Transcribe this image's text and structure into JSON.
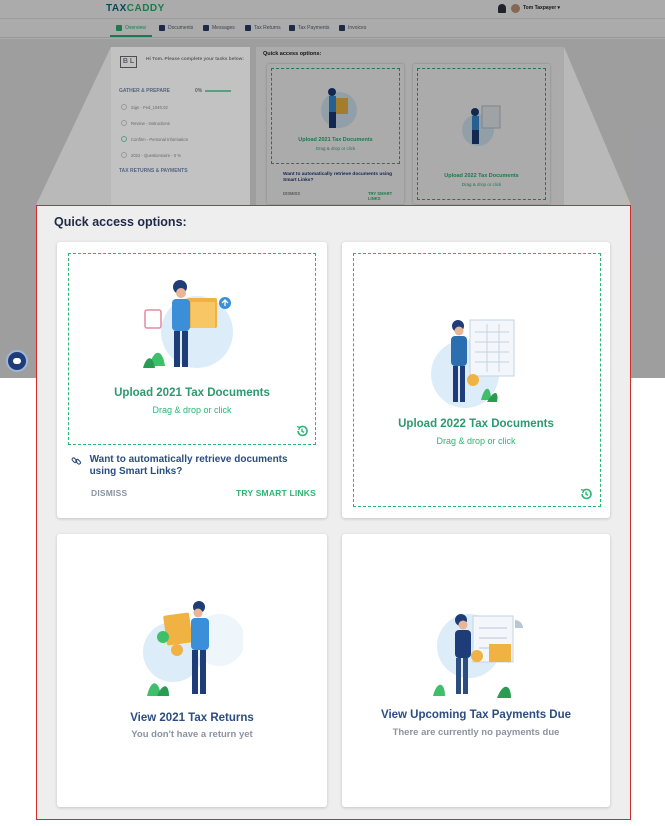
{
  "app": {
    "brand_prefix": "TAX",
    "brand_suffix": "CADDY",
    "user_name": "Tom Taxpayer",
    "colors": {
      "brand_green": "#2bb673",
      "navy": "#2c4d80",
      "highlight_border": "#d02c2c"
    }
  },
  "nav": {
    "tabs": [
      {
        "label": "Overview",
        "icon": "home-icon",
        "active": true
      },
      {
        "label": "Documents",
        "icon": "documents-icon"
      },
      {
        "label": "Messages",
        "icon": "messages-icon"
      },
      {
        "label": "Tax Returns",
        "icon": "tax-returns-icon"
      },
      {
        "label": "Tax Payments",
        "icon": "tax-payments-icon"
      },
      {
        "label": "Invoices",
        "icon": "invoices-icon"
      }
    ]
  },
  "sidebar": {
    "logo_text": "B L",
    "greeting": "Hi Tom. Please complete your tasks below:",
    "gather_header": "GATHER & PREPARE",
    "progress_text": "0%",
    "tasks": [
      "Sign - Fed_1040.02",
      "Review - Instructions",
      "Confirm - Personal Information",
      "2022 - Questionnaire - 0 %"
    ],
    "returns_header": "TAX RETURNS & PAYMENTS"
  },
  "quick_access": {
    "title": "Quick access options:",
    "cards": {
      "upload_2021": {
        "title": "Upload 2021 Tax Documents",
        "subtitle": "Drag & drop or click"
      },
      "upload_2022": {
        "title": "Upload 2022 Tax Documents",
        "subtitle": "Drag & drop or click"
      },
      "view_returns": {
        "title": "View 2021 Tax Returns",
        "subtitle": "You don't have a return yet"
      },
      "view_payments": {
        "title": "View Upcoming Tax Payments Due",
        "subtitle": "There are currently no payments due"
      }
    },
    "smart_links": {
      "text": "Want to automatically retrieve documents using Smart Links?",
      "dismiss": "DISMISS",
      "try": "TRY SMART LINKS"
    }
  }
}
